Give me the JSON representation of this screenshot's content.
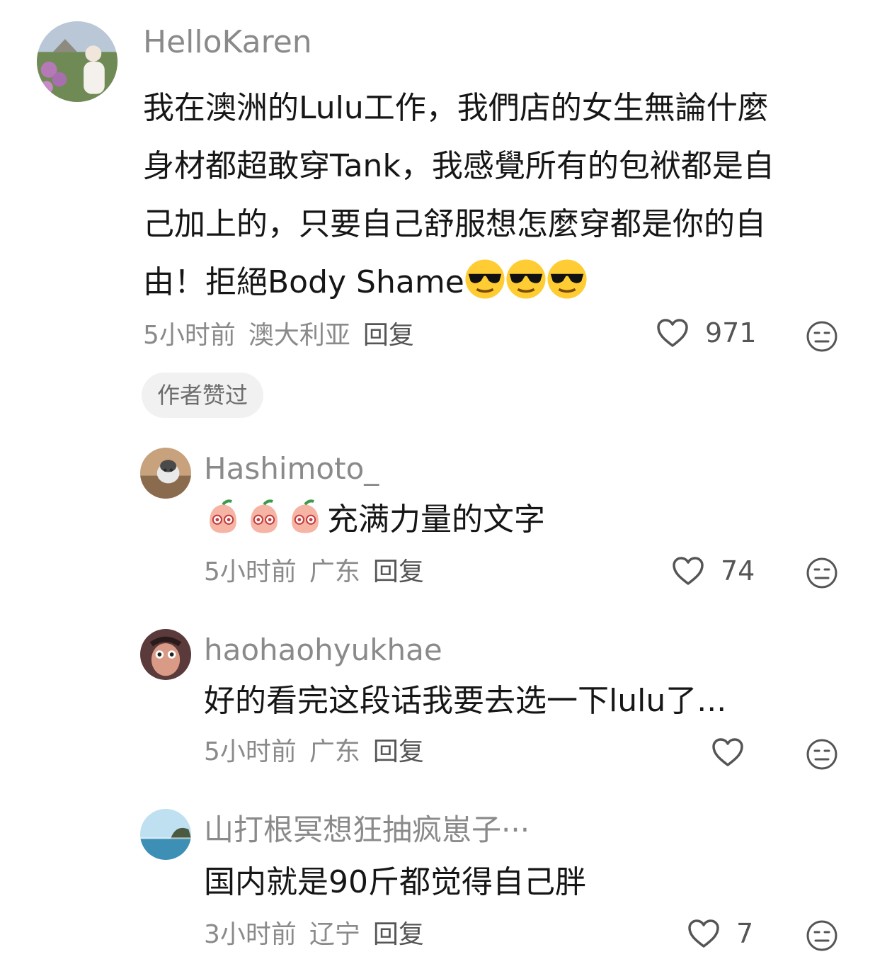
{
  "comments": [
    {
      "username": "HelloKaren",
      "text_lines": [
        "我在澳洲的Lulu工作，我們店的女生無論什麼",
        "身材都超敢穿Tank，我感覺所有的包袱都是自",
        "己加上的，只要自己舒服想怎麼穿都是你的自"
      ],
      "text_last": "由！拒絕Body Shame",
      "emoji": [
        "sunglasses-emoji",
        "sunglasses-emoji",
        "sunglasses-emoji"
      ],
      "time": "5小时前",
      "location": "澳大利亚",
      "reply_label": "回复",
      "likes": "971",
      "badge": "作者赞过"
    },
    {
      "username": "Hashimoto_",
      "emoji": [
        "peach-emoji",
        "peach-emoji",
        "peach-emoji"
      ],
      "text": "充满力量的文字",
      "time": "5小时前",
      "location": "广东",
      "reply_label": "回复",
      "likes": "74"
    },
    {
      "username": "haohaohyukhae",
      "text": "好的看完这段话我要去选一下lulu了...",
      "time": "5小时前",
      "location": "广东",
      "reply_label": "回复",
      "likes": ""
    },
    {
      "username": "山打根冥想狂抽疯崽子···",
      "text": "国内就是90斤都觉得自己胖",
      "time": "3小时前",
      "location": "辽宁",
      "reply_label": "回复",
      "likes": "7"
    }
  ],
  "colors": {
    "meta_gray": "#8a8a8a",
    "text": "#161616",
    "badge_bg": "#f1f1f1"
  }
}
